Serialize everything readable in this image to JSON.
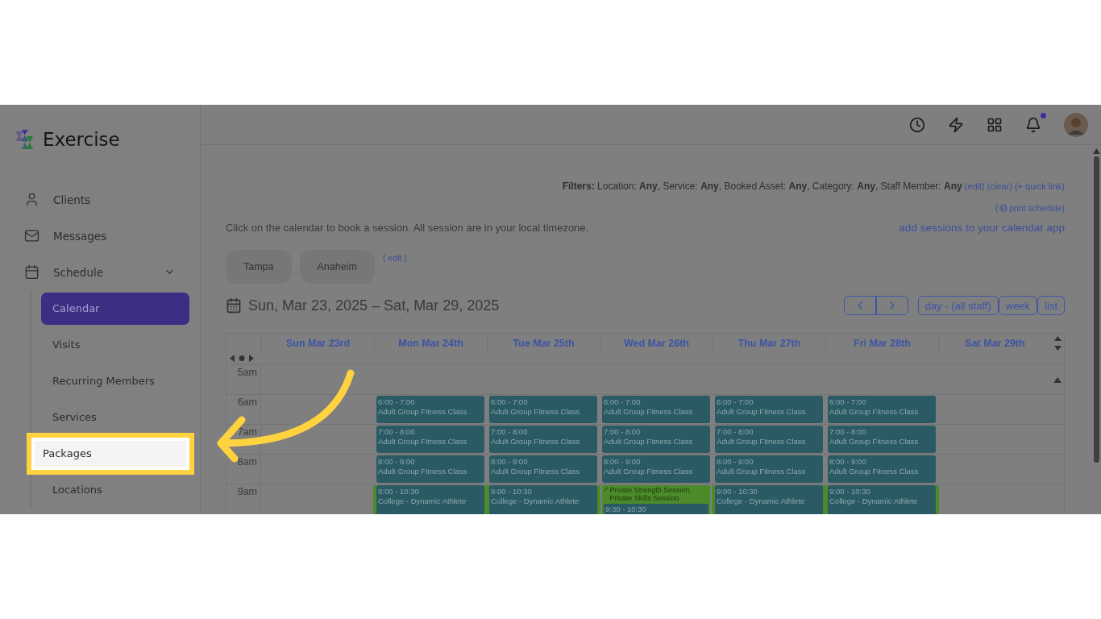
{
  "app": {
    "name": "Exercise"
  },
  "sidebar": {
    "items": [
      {
        "label": "Clients"
      },
      {
        "label": "Messages"
      },
      {
        "label": "Schedule",
        "expanded": true,
        "children": [
          {
            "label": "Calendar",
            "selected": true,
            "highlighted": false
          },
          {
            "label": "Visits",
            "selected": false,
            "highlighted": false
          },
          {
            "label": "Recurring Members",
            "selected": false,
            "highlighted": false
          },
          {
            "label": "Services",
            "selected": false,
            "highlighted": false
          },
          {
            "label": "Packages",
            "selected": false,
            "highlighted": true
          },
          {
            "label": "Locations",
            "selected": false,
            "highlighted": false
          }
        ]
      }
    ]
  },
  "header": {
    "notifications_unread": true
  },
  "filters": {
    "text": "**Filters:** Location: **Any**, Service: **Any**, Booked Asset: **Any**, Category: **Any**, Staff Member: **Any**",
    "links": [
      "(edit)",
      "(clear)",
      "(+ quick link)"
    ]
  },
  "print_link": {
    "before": "(",
    "label": "print schedule",
    "after": ")"
  },
  "info": "Click on the calendar to book a session. All session are in your local timezone.",
  "calendar_app_link": "add sessions to your calendar app",
  "locations": [
    "Tampa",
    "Anaheim"
  ],
  "locations_edit": "( edit )",
  "date_range": "Sun, Mar 23, 2025 – Sat, Mar 29, 2025",
  "views": [
    "day - (all staff)",
    "week",
    "list"
  ],
  "calendar": {
    "days": [
      "Sun Mar 23rd",
      "Mon Mar 24th",
      "Tue Mar 25th",
      "Wed Mar 26th",
      "Thu Mar 27th",
      "Fri Mar 28th",
      "Sat Mar 29th"
    ],
    "rows": [
      {
        "label": "5am",
        "cells": [
          {
            "kind": "empty"
          },
          {
            "kind": "empty"
          },
          {
            "kind": "empty"
          },
          {
            "kind": "empty"
          },
          {
            "kind": "empty"
          },
          {
            "kind": "empty"
          },
          {
            "kind": "empty"
          }
        ]
      },
      {
        "label": "6am",
        "cells": [
          {
            "kind": "empty"
          },
          {
            "kind": "event",
            "time": "6:00 - 7:00",
            "title": "Adult Group Fitness Class"
          },
          {
            "kind": "event",
            "time": "6:00 - 7:00",
            "title": "Adult Group Fitness Class"
          },
          {
            "kind": "event",
            "time": "6:00 - 7:00",
            "title": "Adult Group Fitness Class"
          },
          {
            "kind": "event",
            "time": "6:00 - 7:00",
            "title": "Adult Group Fitness Class"
          },
          {
            "kind": "event",
            "time": "6:00 - 7:00",
            "title": "Adult Group Fitness Class"
          },
          {
            "kind": "empty"
          }
        ]
      },
      {
        "label": "7am",
        "cells": [
          {
            "kind": "empty"
          },
          {
            "kind": "event",
            "time": "7:00 - 8:00",
            "title": "Adult Group Fitness Class"
          },
          {
            "kind": "event",
            "time": "7:00 - 8:00",
            "title": "Adult Group Fitness Class"
          },
          {
            "kind": "event",
            "time": "7:00 - 8:00",
            "title": "Adult Group Fitness Class"
          },
          {
            "kind": "event",
            "time": "7:00 - 8:00",
            "title": "Adult Group Fitness Class"
          },
          {
            "kind": "event",
            "time": "7:00 - 8:00",
            "title": "Adult Group Fitness Class"
          },
          {
            "kind": "empty"
          }
        ]
      },
      {
        "label": "8am",
        "cells": [
          {
            "kind": "empty"
          },
          {
            "kind": "event",
            "time": "8:00 - 9:00",
            "title": "Adult Group Fitness Class"
          },
          {
            "kind": "event",
            "time": "8:00 - 9:00",
            "title": "Adult Group Fitness Class"
          },
          {
            "kind": "event",
            "time": "8:00 - 9:00",
            "title": "Adult Group Fitness Class"
          },
          {
            "kind": "event",
            "time": "8:00 - 9:00",
            "title": "Adult Group Fitness Class"
          },
          {
            "kind": "event",
            "time": "8:00 - 9:00",
            "title": "Adult Group Fitness Class"
          },
          {
            "kind": "empty"
          }
        ]
      },
      {
        "label": "9am",
        "cells": [
          {
            "kind": "empty"
          },
          {
            "kind": "event",
            "overlap": true,
            "time": "9:00 - 10:30",
            "title": "College - Dynamic Athlete"
          },
          {
            "kind": "event",
            "overlap": true,
            "time": "9:00 - 10:30",
            "title": "College - Dynamic Athlete"
          },
          {
            "kind": "group",
            "title": "Private Strength Session, Private Skills Session",
            "time": "9:30 - 10:30"
          },
          {
            "kind": "event",
            "overlap": true,
            "time": "9:00 - 10:30",
            "title": "College - Dynamic Athlete"
          },
          {
            "kind": "event",
            "overlap": true,
            "time": "9:00 - 10:30",
            "title": "College - Dynamic Athlete"
          },
          {
            "kind": "empty"
          }
        ]
      }
    ]
  }
}
